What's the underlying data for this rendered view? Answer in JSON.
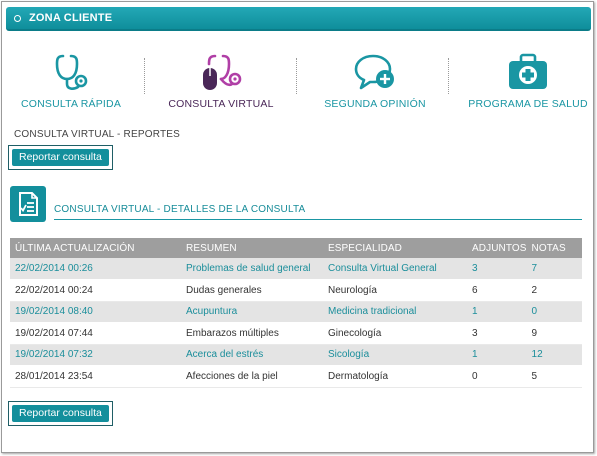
{
  "header": {
    "title": "ZONA CLIENTE"
  },
  "services": [
    {
      "label": "CONSULTA RÁPIDA",
      "icon": "stethoscope-icon"
    },
    {
      "label": "CONSULTA VIRTUAL",
      "icon": "stethoscope-mouse-icon"
    },
    {
      "label": "SEGUNDA OPINIÓN",
      "icon": "speech-bubble-plus-icon"
    },
    {
      "label": "PROGRAMA DE SALUD",
      "icon": "medical-kit-icon"
    }
  ],
  "section_title": "CONSULTA VIRTUAL - REPORTES",
  "report_button_label": "Reportar consulta",
  "details": {
    "title": "CONSULTA VIRTUAL - DETALLES DE LA CONSULTA",
    "icon": "document-check-icon"
  },
  "table": {
    "headers": [
      "ÚLTIMA ACTUALIZACIÓN",
      "RESUMEN",
      "ESPECIALIDAD",
      "ADJUNTOS",
      "NOTAS"
    ],
    "rows": [
      [
        "22/02/2014 00:26",
        "Problemas de salud general",
        "Consulta Virtual General",
        "3",
        "7"
      ],
      [
        "22/02/2014 00:24",
        "Dudas generales",
        "Neurología",
        "6",
        "2"
      ],
      [
        "19/02/2014 08:40",
        "Acupuntura",
        "Medicina tradicional",
        "1",
        "0"
      ],
      [
        "19/02/2014 07:44",
        "Embarazos múltiples",
        "Ginecología",
        "3",
        "9"
      ],
      [
        "19/02/2014 07:32",
        "Acerca del estrés",
        "Sicología",
        "1",
        "12"
      ],
      [
        "28/01/2014 23:54",
        "Afecciones de la piel",
        "Dermatología",
        "0",
        "5"
      ]
    ]
  },
  "colors": {
    "accent": "#138f9c",
    "accent_text": "#1a96a3",
    "virtual_label": "#4a2758",
    "virtual_icon": "#b03fa6",
    "table_header": "#9e9e9e"
  }
}
